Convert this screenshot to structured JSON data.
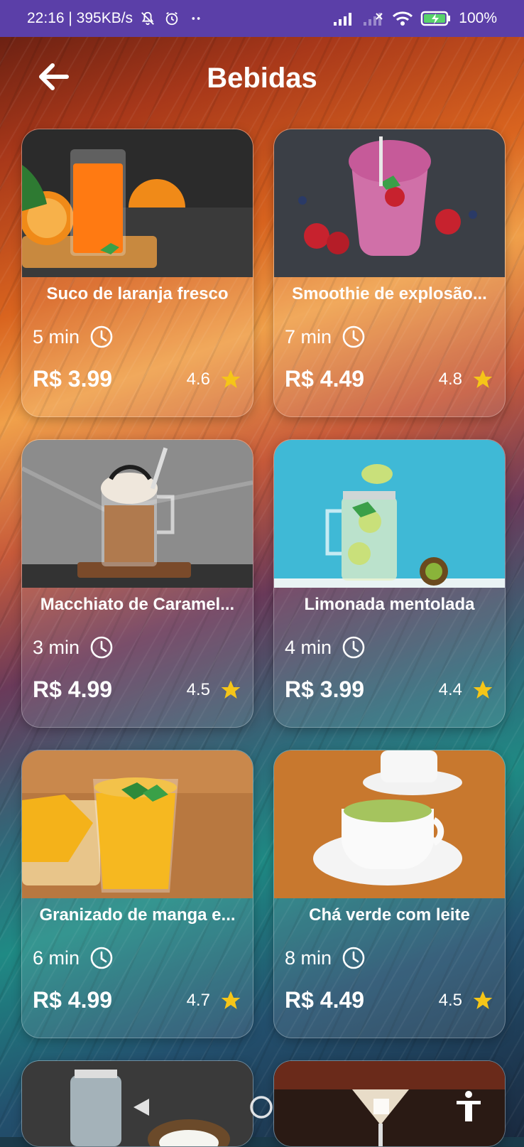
{
  "status_bar": {
    "time_speed": "22:16 | 395KB/s",
    "battery": "100%"
  },
  "header": {
    "title": "Bebidas"
  },
  "products": [
    {
      "name": "Suco de laranja fresco",
      "time": "5 min",
      "price": "R$ 3.99",
      "rating": "4.6"
    },
    {
      "name": "Smoothie de explosão...",
      "time": "7 min",
      "price": "R$ 4.49",
      "rating": "4.8"
    },
    {
      "name": "Macchiato de Caramel...",
      "time": "3 min",
      "price": "R$ 4.99",
      "rating": "4.5"
    },
    {
      "name": "Limonada mentolada",
      "time": "4 min",
      "price": "R$ 3.99",
      "rating": "4.4"
    },
    {
      "name": "Granizado de manga e...",
      "time": "6 min",
      "price": "R$ 4.99",
      "rating": "4.7"
    },
    {
      "name": "Chá verde com leite",
      "time": "8 min",
      "price": "R$ 4.49",
      "rating": "4.5"
    }
  ],
  "colors": {
    "status_bar": "#5b3fa8",
    "star": "#f5c518",
    "text": "#ffffff"
  }
}
